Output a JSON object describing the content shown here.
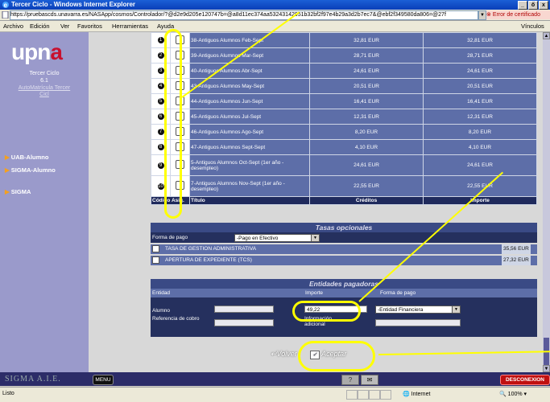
{
  "window": {
    "title": "Tercer Ciclo - Windows Internet Explorer",
    "controls": [
      "_",
      "ő",
      "x"
    ]
  },
  "address": {
    "url": "https://pruebascds.unavarra.es/NASApp/cosmos/Controlador/?@d2e9d205e120747b=@a8d11ec374aa53243142951b32bf2f97e4b29a3d2b7ec7&@ebf2f349580da806=@27f",
    "cert_warning": "Error de certificado"
  },
  "menubar": {
    "items": [
      "Archivo",
      "Edición",
      "Ver",
      "Favoritos",
      "Herramientas",
      "Ayuda"
    ],
    "links_label": "Vínculos"
  },
  "sidebar": {
    "logo_main": "upn",
    "logo_accent": "a",
    "program": "Tercer Ciclo",
    "version": "6.1",
    "link1": "AutoMatrícula Tercer",
    "link2": "Cicl",
    "nav": [
      "UAB-Alumno",
      "SIGMA-Alumno",
      "SIGMA"
    ]
  },
  "fees_table": {
    "rows": [
      {
        "code": "38-Antiguos Alumnos Feb-Sept",
        "credits": "32,81 EUR",
        "amount": "32,81 EUR"
      },
      {
        "code": "39-Antiguos Alumnos Mar-Sept",
        "credits": "28,71 EUR",
        "amount": "28,71 EUR"
      },
      {
        "code": "40-Antiguos Alumnos Abr-Sept",
        "credits": "24,61 EUR",
        "amount": "24,61 EUR"
      },
      {
        "code": "43-Antiguos Alumnos May-Sept",
        "credits": "20,51 EUR",
        "amount": "20,51 EUR"
      },
      {
        "code": "44-Antiguos Alumnos Jun-Sept",
        "credits": "16,41 EUR",
        "amount": "16,41 EUR"
      },
      {
        "code": "45-Antiguos Alumnos Jul-Sept",
        "credits": "12,31 EUR",
        "amount": "12,31 EUR"
      },
      {
        "code": "46-Antiguos Alumnos Ago-Sept",
        "credits": "8,20 EUR",
        "amount": "8,20 EUR"
      },
      {
        "code": "47-Antiguos Alumnos Sept-Sept",
        "credits": "4,10 EUR",
        "amount": "4,10 EUR"
      },
      {
        "code": "5-Antiguos Alumnos Oct-Sept (1er año - desempleo)",
        "credits": "24,61 EUR",
        "amount": "24,61 EUR"
      },
      {
        "code": "7-Antiguos Alumnos Nov-Sept (1er año - desempleo)",
        "credits": "22,55 EUR",
        "amount": "22,55 EUR"
      }
    ],
    "headers": [
      "Código Asig.",
      "Título",
      "Créditos",
      "Importe"
    ]
  },
  "optional_fees": {
    "title": "Tasas opcionales",
    "payment_label": "Forma de pago",
    "payment_value": "-Pago en Efectivo",
    "items": [
      {
        "label": "TASA DE GESTION ADMINISTRATIVA",
        "amount": "35,56 EUR"
      },
      {
        "label": "APERTURA DE EXPEDIENTE (TCS)",
        "amount": "27,32 EUR"
      }
    ]
  },
  "payers": {
    "title": "Entidades pagadoras",
    "headers": [
      "Entidad",
      "Importe",
      "Forma de pago"
    ],
    "row_label": "Alumno",
    "amount": "49,22",
    "payment_value": "-Entidad Financiera",
    "ref_label": "Referencia de cobro",
    "info_label": "Información adicional"
  },
  "actions": {
    "back": "Volver",
    "accept": "Aceptar"
  },
  "footer": {
    "brand": "SIGMA A.I.E.",
    "menu": "MENU",
    "help": "?",
    "disconnect": "DESCONEXION"
  },
  "status": {
    "left": "Listo",
    "zone": "Internet",
    "zoom": "100%"
  },
  "colors": {
    "highlight": "#ffff00",
    "table_bg": "#5d6ea8",
    "header_bg": "#1f2a5c"
  }
}
